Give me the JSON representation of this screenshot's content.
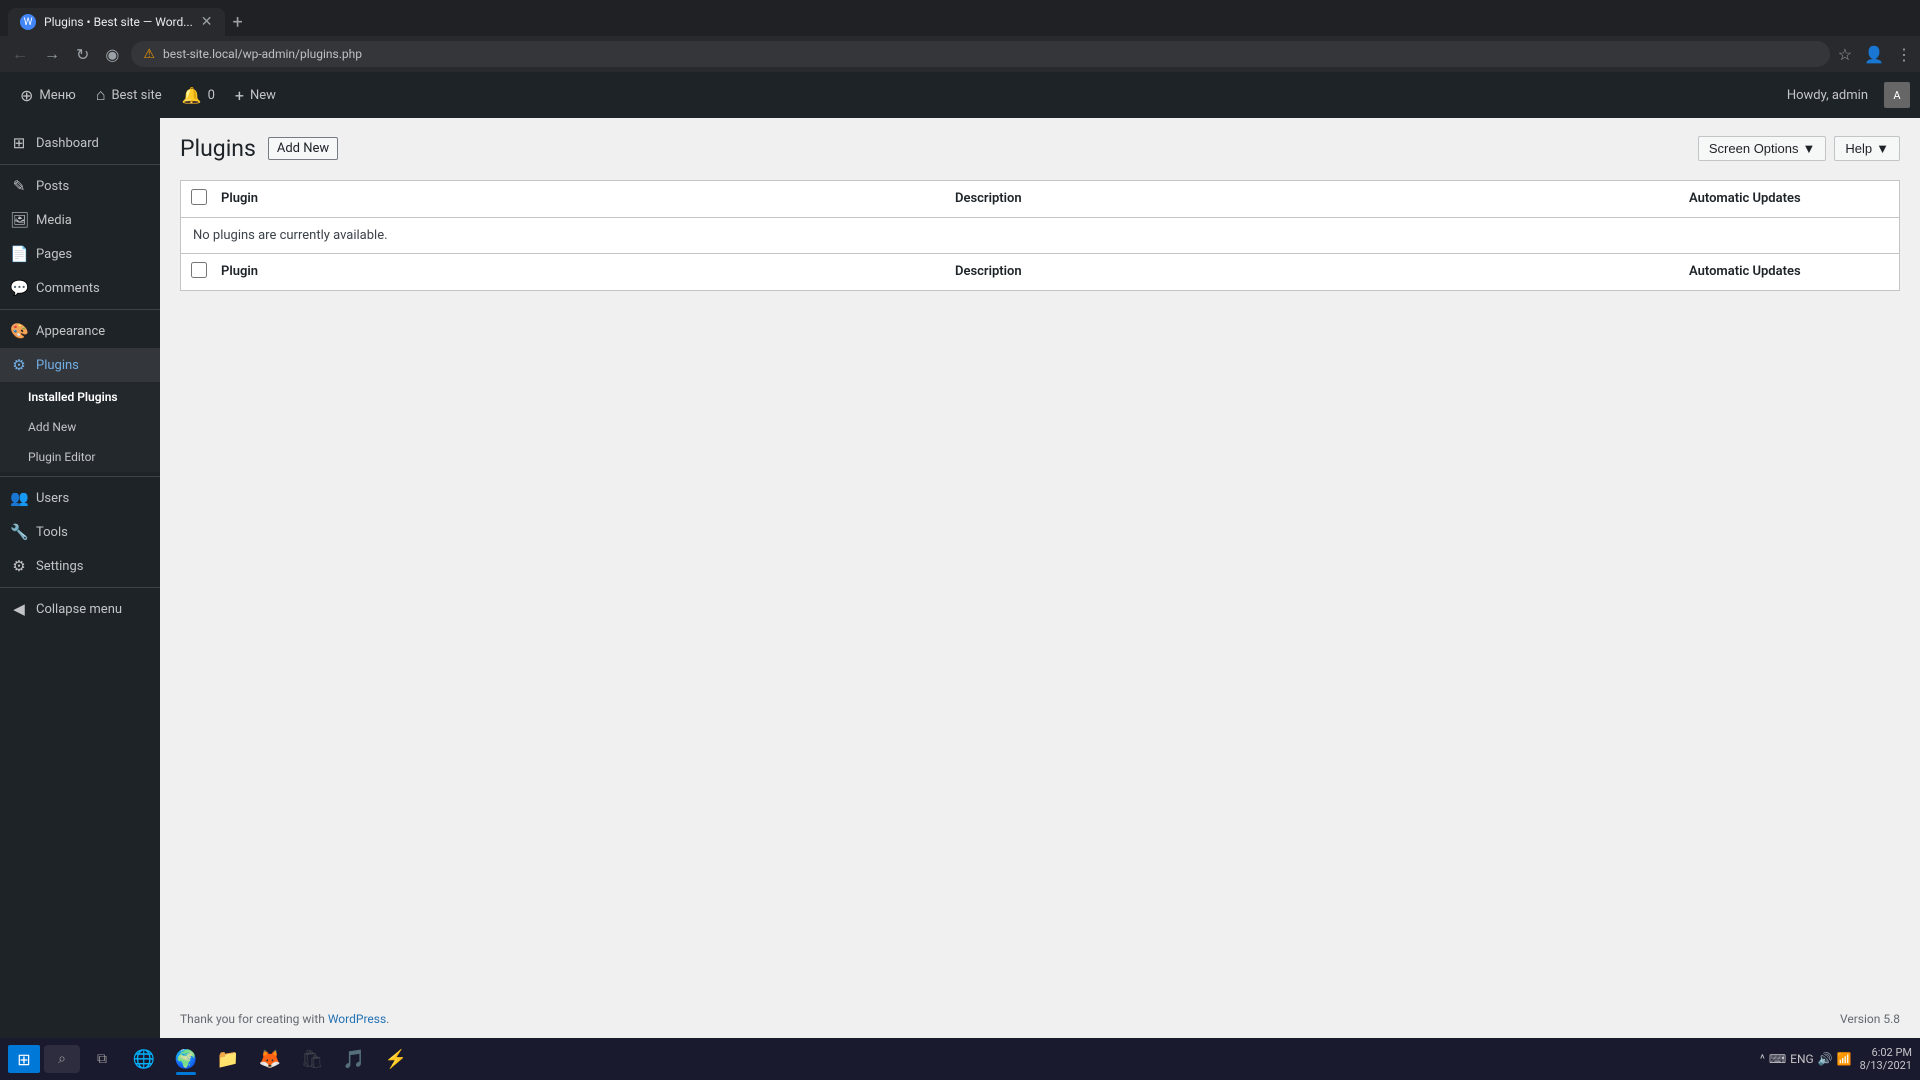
{
  "browser": {
    "tab_title": "Plugins • Best site — Word...",
    "tab_favicon": "W",
    "address": "best-site.local/wp-admin/plugins.php",
    "warning_icon": "⚠"
  },
  "admin_bar": {
    "wp_icon": "W",
    "menu_label": "Меню",
    "site_icon": "⌂",
    "site_name": "Best site",
    "updates_icon": "🔔",
    "updates_count": "0",
    "new_label": "New",
    "howdy": "Howdy, admin"
  },
  "sidebar": {
    "dashboard": "Dashboard",
    "posts": "Posts",
    "media": "Media",
    "pages": "Pages",
    "comments": "Comments",
    "appearance": "Appearance",
    "plugins": "Plugins",
    "plugins_installed": "Installed Plugins",
    "plugins_add_new": "Add New",
    "plugins_editor": "Plugin Editor",
    "users": "Users",
    "tools": "Tools",
    "settings": "Settings",
    "collapse_menu": "Collapse menu"
  },
  "page": {
    "title": "Plugins",
    "add_new_btn": "Add New",
    "screen_options": "Screen Options",
    "help": "Help"
  },
  "table": {
    "col_checkbox": "",
    "col_plugin": "Plugin",
    "col_description": "Description",
    "col_auto_updates": "Automatic Updates",
    "empty_message": "No plugins are currently available."
  },
  "footer": {
    "thank_you": "Thank you for creating with",
    "wordpress_link": "WordPress",
    "version": "Version 5.8"
  },
  "taskbar": {
    "time": "6:02 PM",
    "date": "8/13/2021",
    "language": "ENG"
  }
}
